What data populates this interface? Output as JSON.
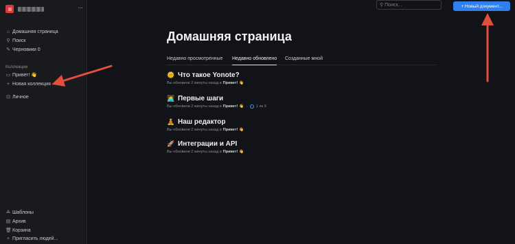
{
  "sidebar": {
    "workspace_more": "···",
    "nav": [
      {
        "icon": "home-icon",
        "glyph": "⌂",
        "label": "Домашняя страница"
      },
      {
        "icon": "search-icon",
        "glyph": "⚲",
        "label": "Поиск"
      },
      {
        "icon": "pencil-icon",
        "glyph": "✎",
        "label": "Черновики 0"
      }
    ],
    "collections_label": "Коллекции",
    "collections": [
      {
        "icon": "collection-icon",
        "glyph": "▭",
        "label": "Привет! 👋"
      },
      {
        "icon": "plus-icon",
        "glyph": "+",
        "label": "Новая коллекция"
      }
    ],
    "personal": {
      "icon": "lock-icon",
      "glyph": "⊡",
      "label": "Личное"
    },
    "bottom": [
      {
        "icon": "templates-icon",
        "glyph": "⟁",
        "label": "Шаблоны"
      },
      {
        "icon": "archive-icon",
        "glyph": "▤",
        "label": "Архив"
      },
      {
        "icon": "trash-icon",
        "glyph": "🗑",
        "label": "Корзина"
      },
      {
        "icon": "invite-icon",
        "glyph": "+",
        "label": "Пригласить людей..."
      }
    ]
  },
  "header": {
    "search_placeholder": "Поиск...",
    "new_doc_label": "+ Новый документ..."
  },
  "main": {
    "title": "Домашняя страница",
    "tabs": [
      "Недавно просмотренные",
      "Недавно обновлено",
      "Созданные мной"
    ],
    "active_tab": 1,
    "documents": [
      {
        "emoji": "🌞",
        "title": "Что такое Yonote?",
        "meta_prefix": "Вы обновили 2 минуты назад в",
        "collection": "Привет!",
        "collection_emoji": "👋",
        "progress": ""
      },
      {
        "emoji": "🧑‍💻",
        "title": "Первые шаги",
        "meta_prefix": "Вы обновили 2 минуты назад в",
        "collection": "Привет!",
        "collection_emoji": "👋",
        "progress": "1 из 9"
      },
      {
        "emoji": "🧘",
        "title": "Наш редактор",
        "meta_prefix": "Вы обновили 2 минуты назад в",
        "collection": "Привет!",
        "collection_emoji": "👋",
        "progress": ""
      },
      {
        "emoji": "🚀",
        "title": "Интеграции и API",
        "meta_prefix": "Вы обновили 2 минуты назад в",
        "collection": "Привет!",
        "collection_emoji": "👋",
        "progress": ""
      }
    ]
  },
  "colors": {
    "accent": "#2f80ed",
    "annotation_arrow": "#e0503c",
    "background": "#111319",
    "sidebar": "#191a1e"
  }
}
